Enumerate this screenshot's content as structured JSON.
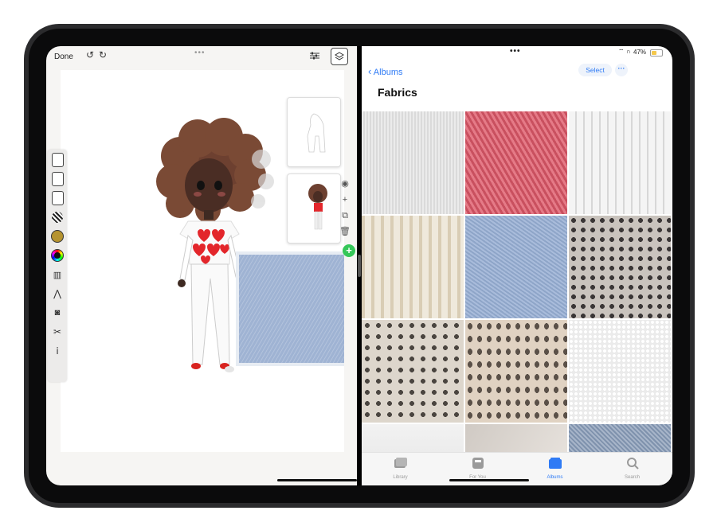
{
  "left_app": {
    "done_label": "Done",
    "icons": [
      "undo-icon",
      "redo-icon",
      "more-dots-icon",
      "adjustments-icon",
      "layers-icon"
    ],
    "tools": [
      "pen-tool-icon",
      "brush-tool-icon",
      "dot-tool-icon",
      "pattern-tool-icon",
      "texture-tool-icon",
      "color-wheel-icon",
      "ruler-tool-icon",
      "compass-tool-icon",
      "camera-icon",
      "scissors-icon",
      "eyedropper-icon"
    ],
    "layer_actions": [
      "eye-icon",
      "plus-icon",
      "duplicate-icon",
      "trash-icon"
    ]
  },
  "right_app": {
    "status": {
      "battery_text": "47%",
      "battery_level": 0.47
    },
    "back_label": "Albums",
    "select_label": "Select",
    "album_title": "Fabrics",
    "tabs": [
      {
        "label": "Library",
        "active": false
      },
      {
        "label": "For You",
        "active": false
      },
      {
        "label": "Albums",
        "active": true
      },
      {
        "label": "Search",
        "active": false
      }
    ],
    "colors": {
      "accent": "#2f7bf5",
      "add_green": "#35c759"
    }
  }
}
